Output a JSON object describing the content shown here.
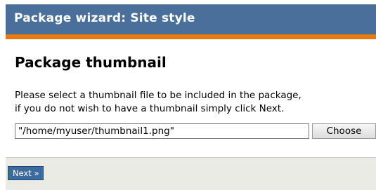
{
  "header": {
    "title": "Package wizard: Site style"
  },
  "main": {
    "heading": "Package thumbnail",
    "description_line1": "Please select a thumbnail file to be included in the package,",
    "description_line2": "if you do not wish to have a thumbnail simply click Next.",
    "file_value": "\"/home/myuser/thumbnail1.png\"",
    "choose_label": "Choose"
  },
  "footer": {
    "next_label": "Next »"
  },
  "colors": {
    "header_bg": "#4a6f9a",
    "accent": "#e77a12",
    "footer_bg": "#ebebe5",
    "button_bg": "#3c6c9f"
  }
}
